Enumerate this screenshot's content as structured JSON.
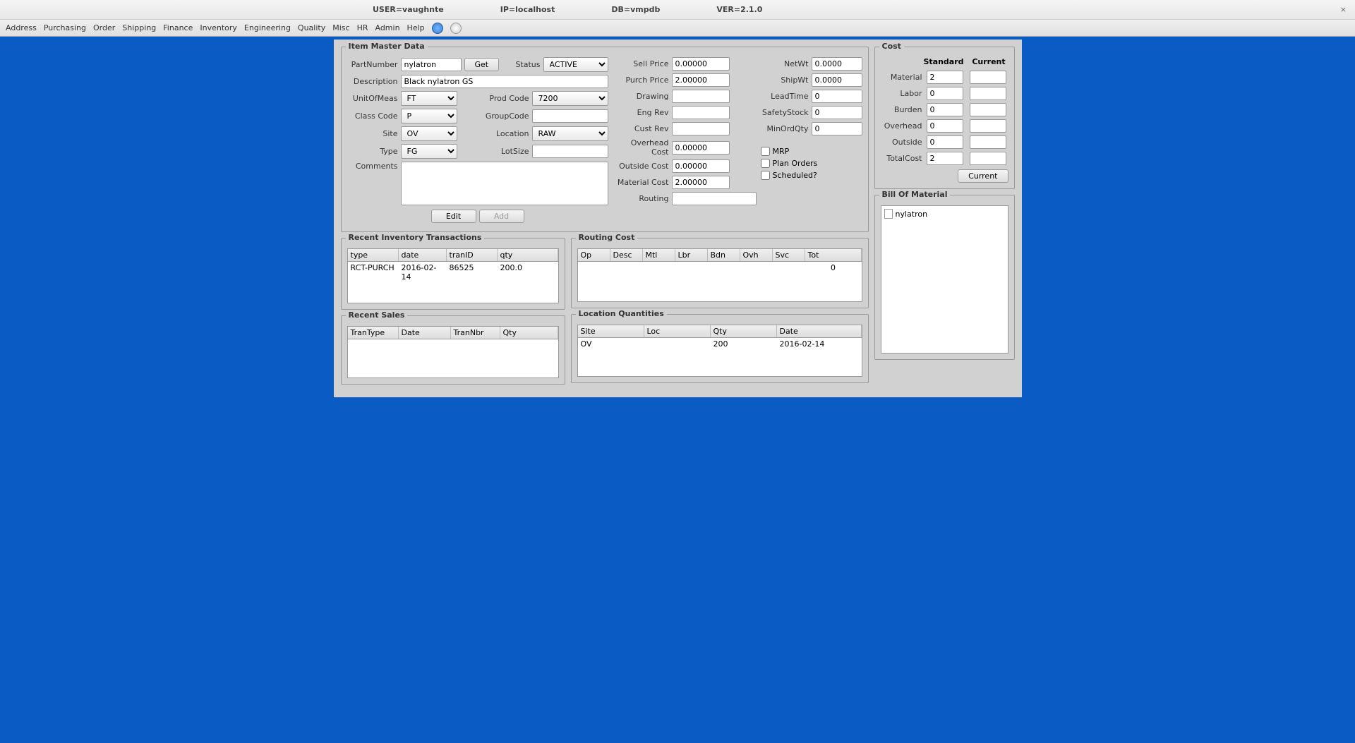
{
  "topbar": {
    "user": "USER=vaughnte",
    "ip": "IP=localhost",
    "db": "DB=vmpdb",
    "ver": "VER=2.1.0"
  },
  "menu": [
    "Address",
    "Purchasing",
    "Order",
    "Shipping",
    "Finance",
    "Inventory",
    "Engineering",
    "Quality",
    "Misc",
    "HR",
    "Admin",
    "Help"
  ],
  "item": {
    "title": "Item Master Data",
    "labels": {
      "partnumber": "PartNumber",
      "get": "Get",
      "status": "Status",
      "description": "Description",
      "uom": "UnitOfMeas",
      "prodcode": "Prod Code",
      "classcode": "Class Code",
      "groupcode": "GroupCode",
      "site": "Site",
      "location": "Location",
      "type": "Type",
      "lotsize": "LotSize",
      "comments": "Comments",
      "sellprice": "Sell Price",
      "purchprice": "Purch Price",
      "drawing": "Drawing",
      "engrev": "Eng Rev",
      "custrev": "Cust Rev",
      "overheadcost": "Overhead Cost",
      "outsidecost": "Outside Cost",
      "materialcost": "Material Cost",
      "routing": "Routing",
      "netwt": "NetWt",
      "shipwt": "ShipWt",
      "leadtime": "LeadTime",
      "safetystock": "SafetyStock",
      "minordqty": "MinOrdQty",
      "mrp": "MRP",
      "planorders": "Plan Orders",
      "scheduled": "Scheduled?",
      "edit": "Edit",
      "add": "Add"
    },
    "values": {
      "partnumber": "nylatron",
      "status": "ACTIVE",
      "description": "Black nylatron GS",
      "uom": "FT",
      "prodcode": "7200",
      "classcode": "P",
      "groupcode": "",
      "site": "OV",
      "location": "RAW",
      "type": "FG",
      "lotsize": "",
      "comments": "",
      "sellprice": "0.00000",
      "purchprice": "2.00000",
      "drawing": "",
      "engrev": "",
      "custrev": "",
      "overheadcost": "0.00000",
      "outsidecost": "0.00000",
      "materialcost": "2.00000",
      "routing": "",
      "netwt": "0.0000",
      "shipwt": "0.0000",
      "leadtime": "0",
      "safetystock": "0",
      "minordqty": "0"
    }
  },
  "cost": {
    "title": "Cost",
    "hdr_std": "Standard",
    "hdr_cur": "Current",
    "labels": {
      "material": "Material",
      "labor": "Labor",
      "burden": "Burden",
      "overhead": "Overhead",
      "outside": "Outside",
      "total": "TotalCost",
      "btn": "Current"
    },
    "std": {
      "material": "2",
      "labor": "0",
      "burden": "0",
      "overhead": "0",
      "outside": "0",
      "total": "2"
    },
    "cur": {
      "material": "",
      "labor": "",
      "burden": "",
      "overhead": "",
      "outside": "",
      "total": ""
    }
  },
  "bom": {
    "title": "Bill Of Material",
    "root": "nylatron"
  },
  "invtrans": {
    "title": "Recent Inventory Transactions",
    "cols": [
      "type",
      "date",
      "tranID",
      "qty"
    ],
    "rows": [
      [
        "RCT-PURCH",
        "2016-02-14",
        "86525",
        "200.0"
      ]
    ]
  },
  "sales": {
    "title": "Recent Sales",
    "cols": [
      "TranType",
      "Date",
      "TranNbr",
      "Qty"
    ]
  },
  "routing": {
    "title": "Routing Cost",
    "cols": [
      "Op",
      "Desc",
      "Mtl",
      "Lbr",
      "Bdn",
      "Ovh",
      "Svc",
      "Tot"
    ],
    "totrow": "0"
  },
  "locqty": {
    "title": "Location Quantities",
    "cols": [
      "Site",
      "Loc",
      "Qty",
      "Date"
    ],
    "rows": [
      [
        "OV",
        "",
        "200",
        "2016-02-14"
      ]
    ]
  }
}
